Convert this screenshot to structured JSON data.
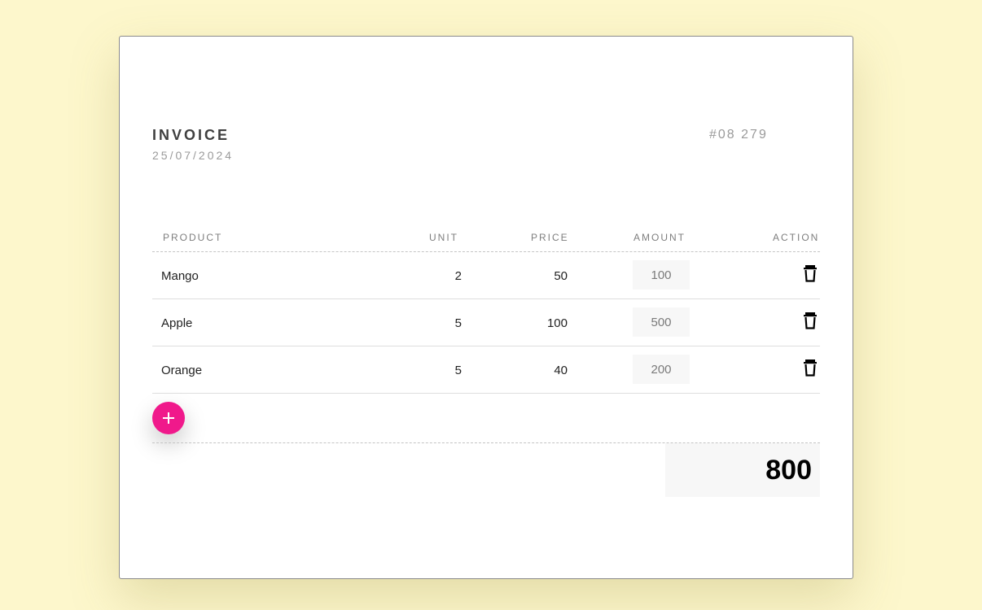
{
  "invoice": {
    "title": "INVOICE",
    "date": "25/07/2024",
    "number": "#08 279"
  },
  "table": {
    "headers": [
      "PRODUCT",
      "UNIT",
      "PRICE",
      "AMOUNT",
      "ACTION"
    ],
    "rows": [
      {
        "product": "Mango",
        "unit": "2",
        "price": "50",
        "amount": "100"
      },
      {
        "product": "Apple",
        "unit": "5",
        "price": "100",
        "amount": "500"
      },
      {
        "product": "Orange",
        "unit": "5",
        "price": "40",
        "amount": "200"
      }
    ]
  },
  "total": "800",
  "icons": {
    "delete": "trash-icon",
    "add": "plus-icon"
  },
  "colors": {
    "background": "#fdf7cc",
    "accent": "#f0198b"
  }
}
